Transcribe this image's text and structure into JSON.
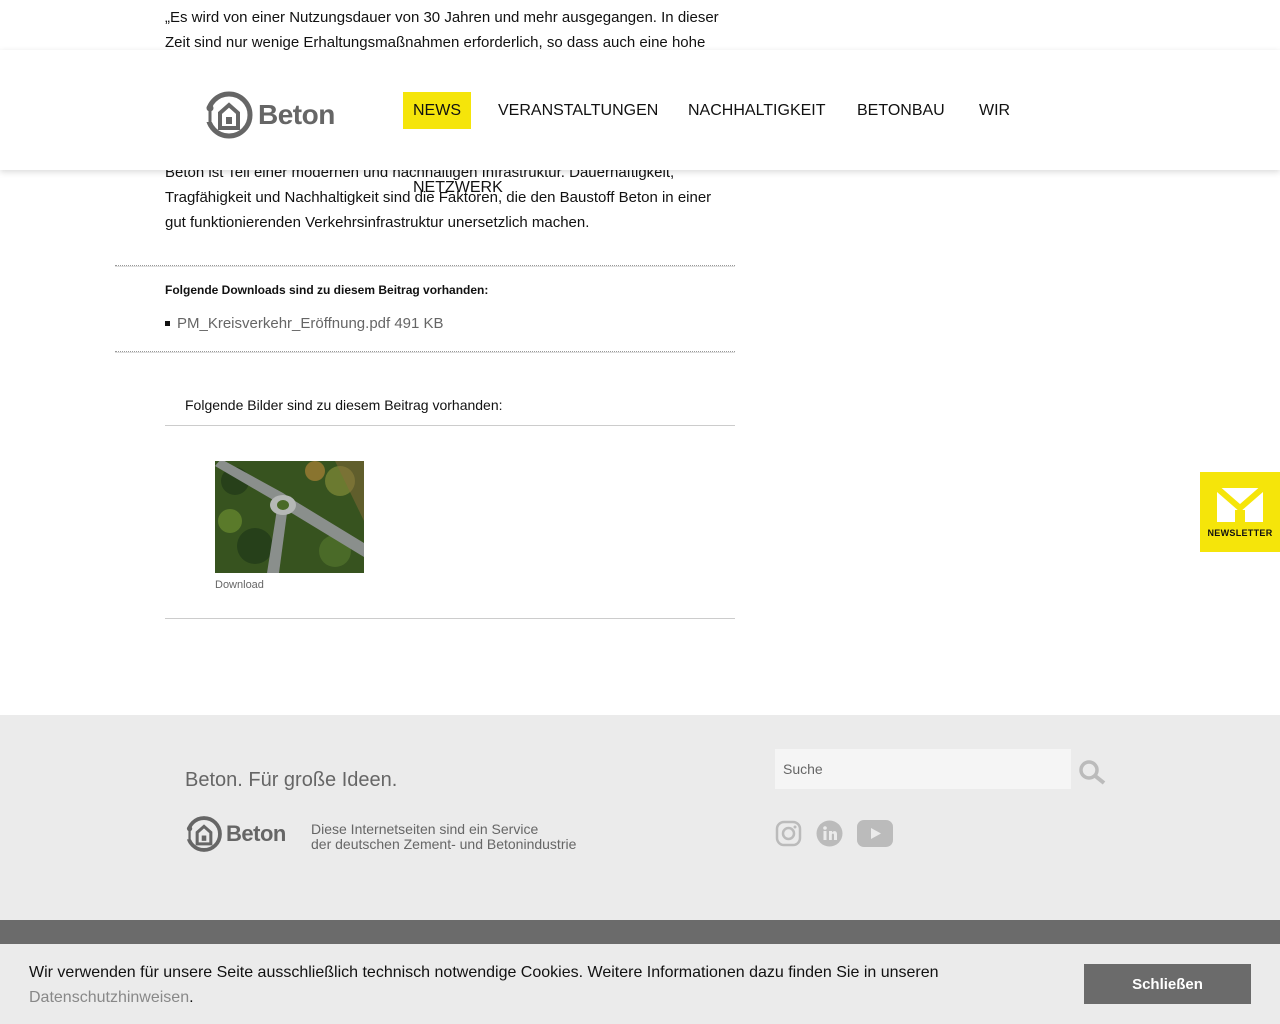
{
  "article": {
    "quote_line1": "„Es wird von einer Nutzungsdauer von 30 Jahren und mehr ausgegangen. In dieser",
    "quote_line2": "Zeit sind nur wenige Erhaltungsmaßnahmen erforderlich, so dass auch eine hohe",
    "para_line1": "Beton ist Teil einer modernen und nachhaltigen Infrastruktur. Dauerhaftigkeit,",
    "para_line2": "Tragfähigkeit und Nachhaltigkeit sind die Faktoren, die den Baustoff Beton in einer",
    "para_line3": "gut funktionierenden Verkehrsinfrastruktur unersetzlich machen."
  },
  "header": {
    "logo_text": "Beton",
    "nav": [
      "NEWS",
      "VERANSTALTUNGEN",
      "NACHHALTIGKEIT",
      "BETONBAU",
      "WIR",
      "NETZWERK"
    ]
  },
  "downloads": {
    "heading": "Folgende Downloads sind zu diesem Beitrag vorhanden:",
    "items": [
      {
        "name": "PM_Kreisverkehr_Eröffnung.pdf",
        "size": "491 KB"
      }
    ]
  },
  "images": {
    "heading": "Folgende Bilder sind zu diesem Beitrag vorhanden:",
    "download_label": "Download"
  },
  "newsletter": {
    "label": "NEWSLETTER",
    "accent": "#f5e50a"
  },
  "footer": {
    "slogan": "Beton. Für große Ideen.",
    "logo_text": "Beton",
    "info_line1": "Diese Internetseiten sind ein Service",
    "info_line2": "der deutschen Zement- und Betonindustrie",
    "search_placeholder": "Suche",
    "social": [
      "instagram-icon",
      "linkedin-icon",
      "youtube-icon"
    ]
  },
  "cookie": {
    "text": "Wir verwenden für unsere Seite ausschließlich technisch notwendige Cookies. Weitere Informationen dazu finden Sie in unseren",
    "link": "Datenschutzhinweisen",
    "suffix": ".",
    "button": "Schließen"
  }
}
